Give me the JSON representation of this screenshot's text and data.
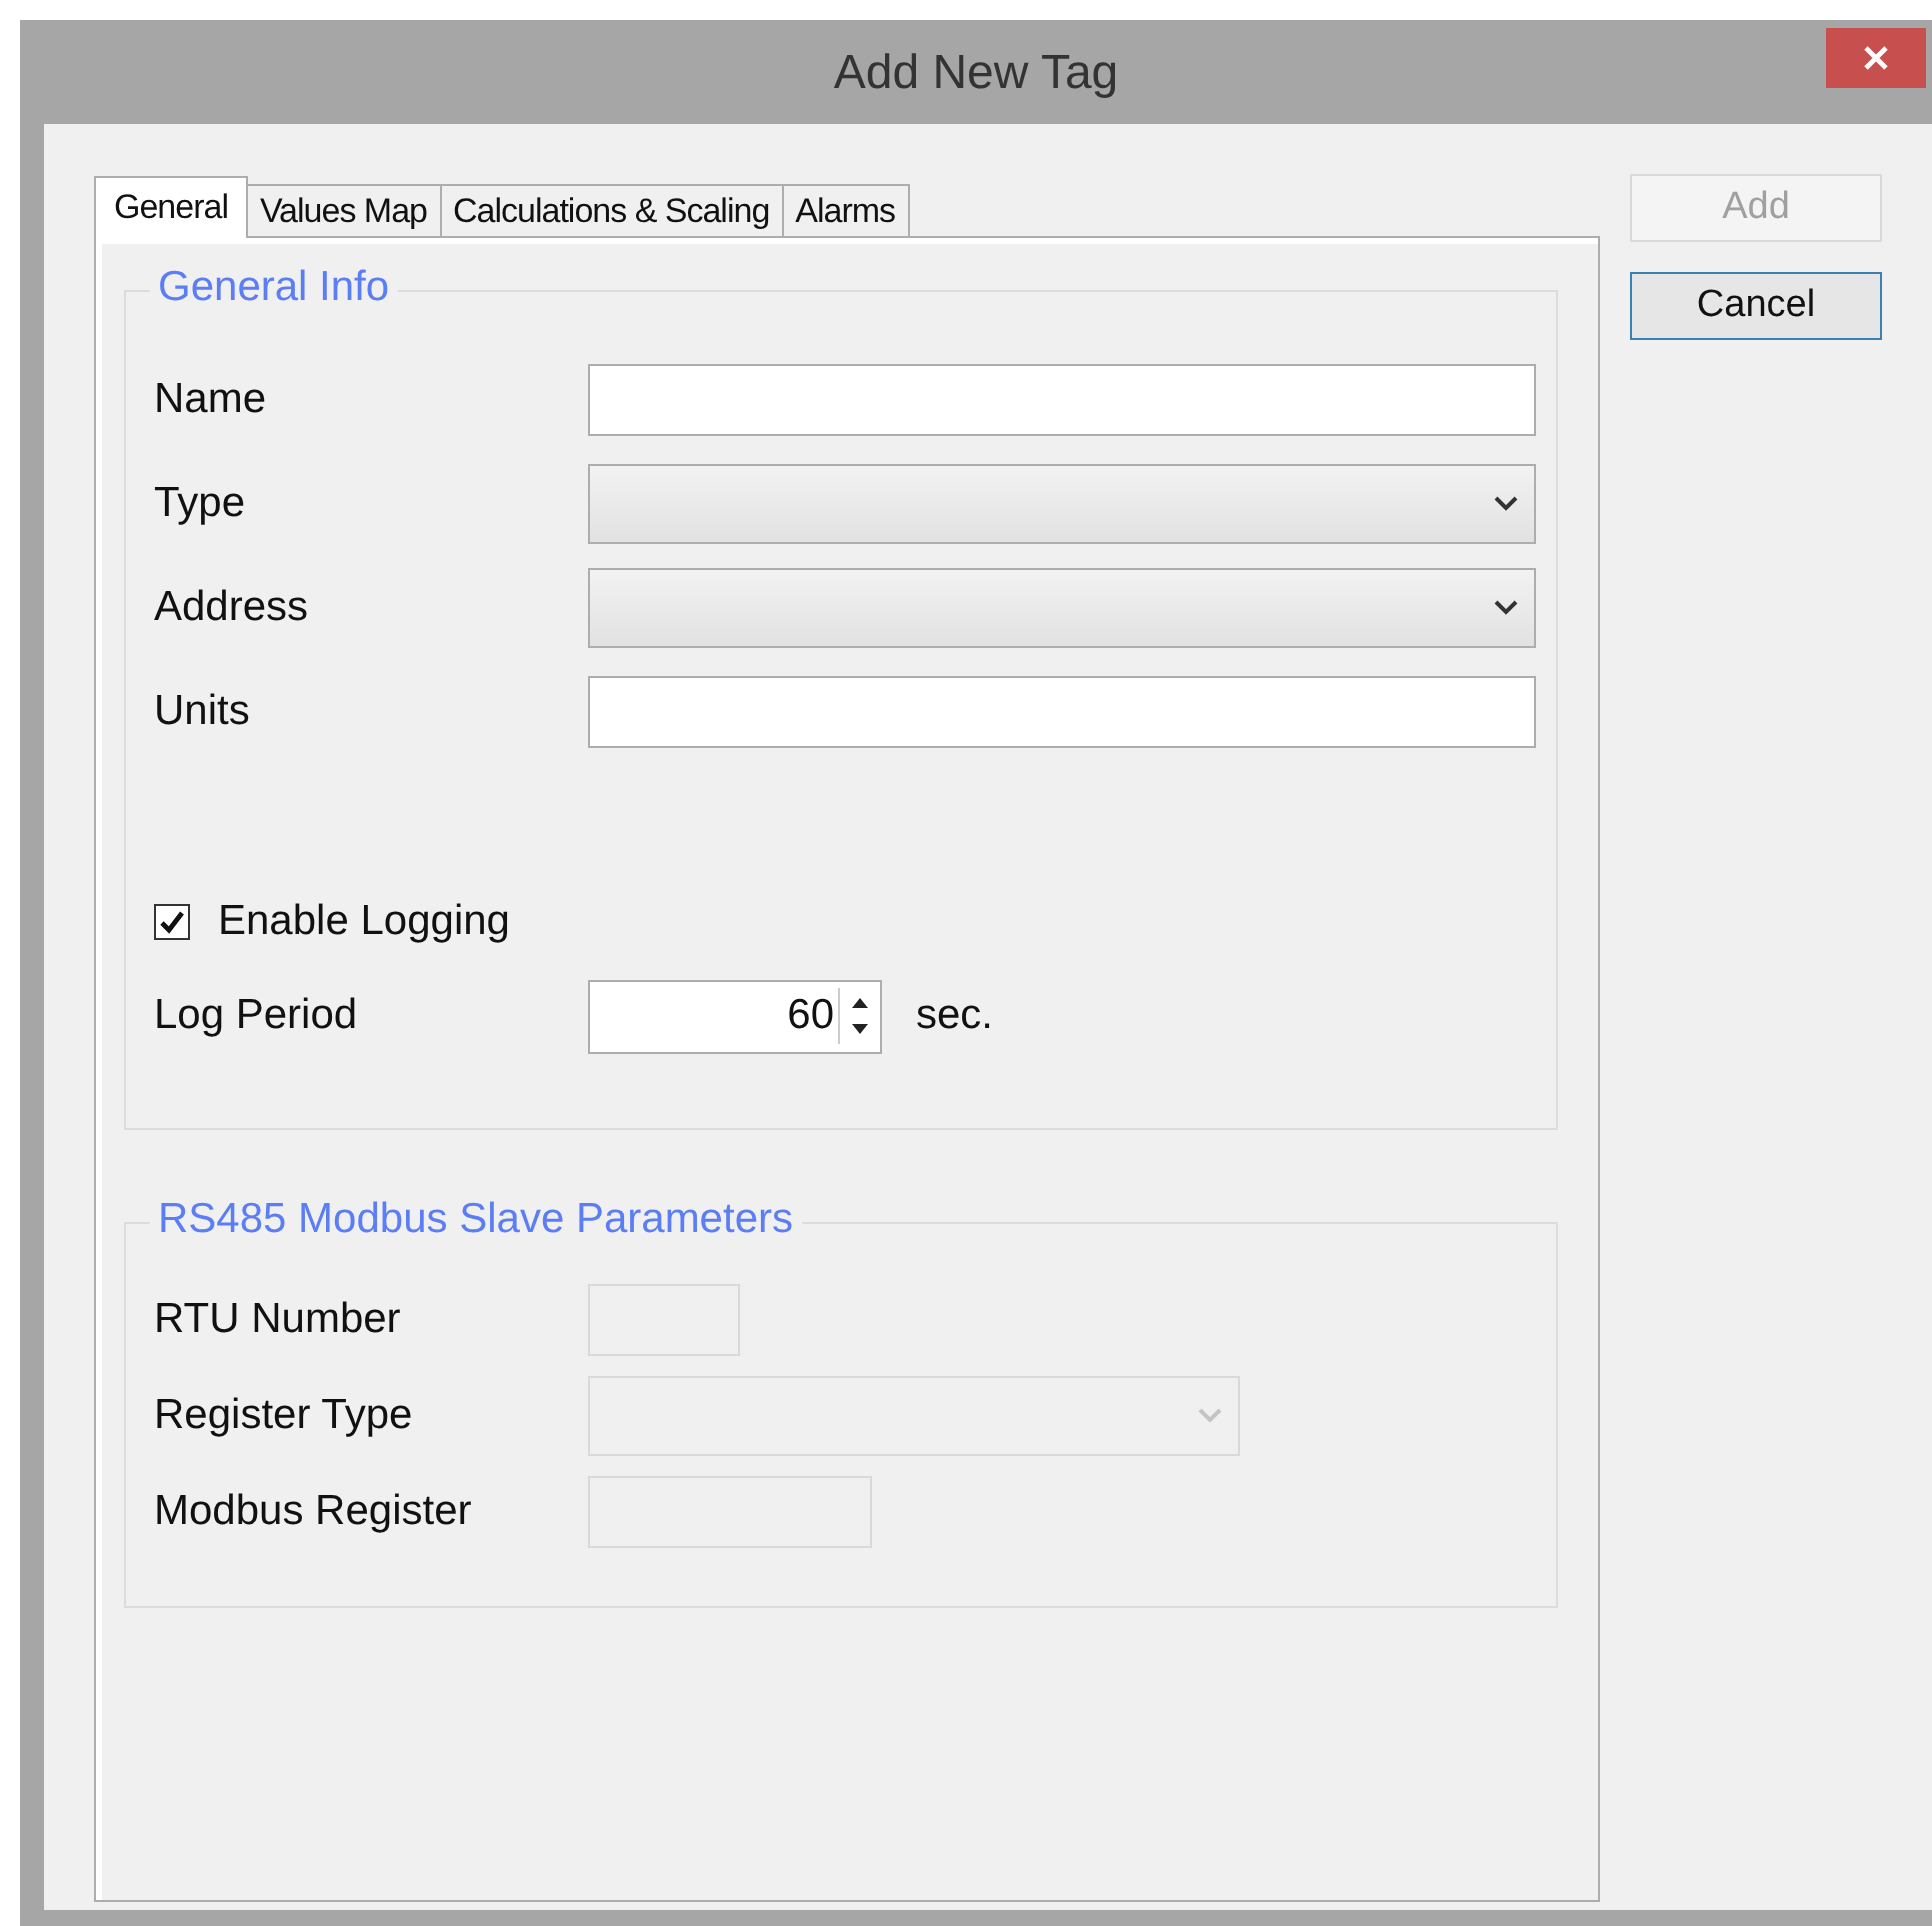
{
  "window": {
    "title": "Add New Tag"
  },
  "tabs": [
    {
      "label": "General",
      "selected": true
    },
    {
      "label": "Values Map",
      "selected": false
    },
    {
      "label": "Calculations & Scaling",
      "selected": false
    },
    {
      "label": "Alarms",
      "selected": false
    }
  ],
  "buttons": [
    {
      "label": "Add",
      "disabled": true,
      "focused": false
    },
    {
      "label": "Cancel",
      "disabled": false,
      "focused": true
    }
  ],
  "groups": [
    {
      "title": "General Info",
      "fields": [
        {
          "kind": "text",
          "label": "Name",
          "disabled": false
        },
        {
          "kind": "select",
          "label": "Type",
          "disabled": false
        },
        {
          "kind": "select",
          "label": "Address",
          "disabled": false
        },
        {
          "kind": "text",
          "label": "Units",
          "disabled": false
        },
        {
          "kind": "checkbox",
          "label": "Enable Logging",
          "checked": true,
          "disabled": false
        },
        {
          "kind": "spin",
          "label": "Log Period",
          "value": "60",
          "suffix": "sec.",
          "disabled": false
        }
      ]
    },
    {
      "title": "RS485 Modbus Slave Parameters",
      "fields": [
        {
          "kind": "short",
          "label": "RTU Number",
          "disabled": true
        },
        {
          "kind": "midselect",
          "label": "Register Type",
          "disabled": true
        },
        {
          "kind": "medium",
          "label": "Modbus Register",
          "disabled": true
        }
      ]
    }
  ]
}
